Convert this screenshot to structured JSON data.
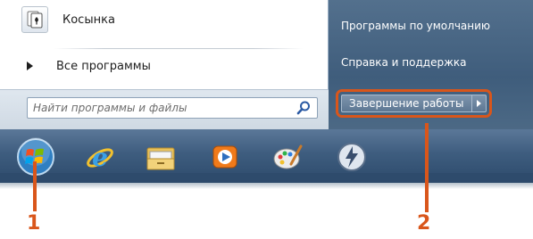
{
  "start_menu": {
    "pinned_program": {
      "label": "Косынка",
      "icon": "solitaire-icon"
    },
    "all_programs_label": "Все программы",
    "search": {
      "placeholder": "Найти программы и файлы",
      "icon": "search-icon"
    },
    "right_links": [
      "Программы по умолчанию",
      "Справка и поддержка"
    ],
    "shutdown_label": "Завершение работы"
  },
  "taskbar": {
    "icons": [
      "windows-orb-icon",
      "internet-explorer-icon",
      "folder-icon",
      "media-player-icon",
      "paint-icon",
      "app-logo-icon"
    ]
  },
  "callouts": {
    "one": "1",
    "two": "2"
  },
  "colors": {
    "callout": "#d9561b",
    "right_pane": "#4a6786",
    "taskbar": "#3e5d7f"
  }
}
